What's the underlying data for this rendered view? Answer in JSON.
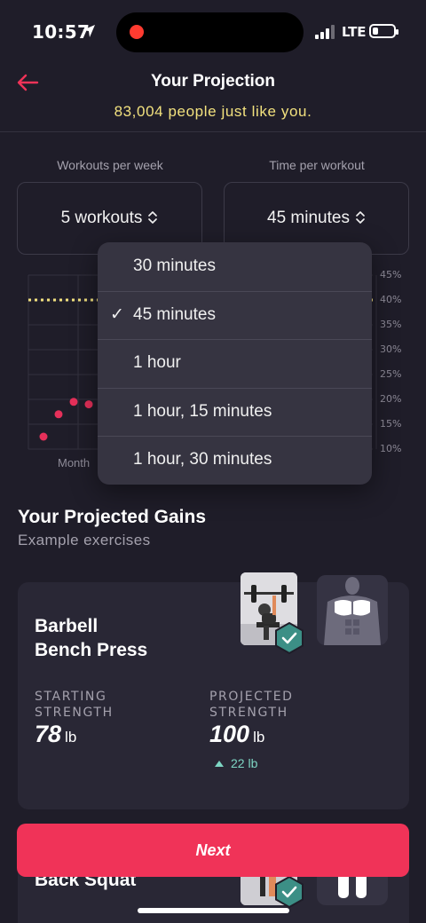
{
  "status_bar": {
    "time": "10:57",
    "network": "LTE",
    "battery_level": 0.15
  },
  "header": {
    "title": "Your Projection",
    "subtitle": "83,004 people just like you."
  },
  "selectors": {
    "workouts_label": "Workouts per week",
    "workouts_value": "5 workouts",
    "time_label": "Time per workout",
    "time_value": "45 minutes"
  },
  "chart": {
    "y_ticks": [
      "45%",
      "40%",
      "35%",
      "30%",
      "25%",
      "20%",
      "15%",
      "10%"
    ],
    "x_label_partial": "Month",
    "dashed_line_color": "#f2e17e",
    "point_color": "#e6305a"
  },
  "chart_data": {
    "type": "scatter",
    "ylim": [
      10,
      45
    ],
    "y_ticks": [
      "45%",
      "40%",
      "35%",
      "30%",
      "25%",
      "20%",
      "15%",
      "10%"
    ],
    "target_line": 40,
    "points": [
      {
        "x": 1,
        "y": 12.5
      },
      {
        "x": 2,
        "y": 17
      },
      {
        "x": 3,
        "y": 19.5
      },
      {
        "x": 4,
        "y": 19
      }
    ]
  },
  "dropdown": {
    "selected_index": 1,
    "options": [
      "30 minutes",
      "45 minutes",
      "1 hour",
      "1 hour, 15 minutes",
      "1 hour, 30 minutes"
    ]
  },
  "gains": {
    "title": "Your Projected Gains",
    "subtitle": "Example exercises"
  },
  "exercise1": {
    "name_line1": "Barbell",
    "name_line2": "Bench Press",
    "starting_label_1": "STARTING",
    "starting_label_2": "STRENGTH",
    "starting_value": "78",
    "starting_unit": "lb",
    "projected_label_1": "PROJECTED",
    "projected_label_2": "STRENGTH",
    "projected_value": "100",
    "projected_unit": "lb",
    "delta": "22 lb"
  },
  "exercise2": {
    "name": "Back Squat"
  },
  "next_button": "Next",
  "colors": {
    "background": "#1f1d29",
    "card": "#292735",
    "accent": "#f03358",
    "subtitle_yellow": "#f2e17e",
    "teal": "#7ed6c4"
  }
}
